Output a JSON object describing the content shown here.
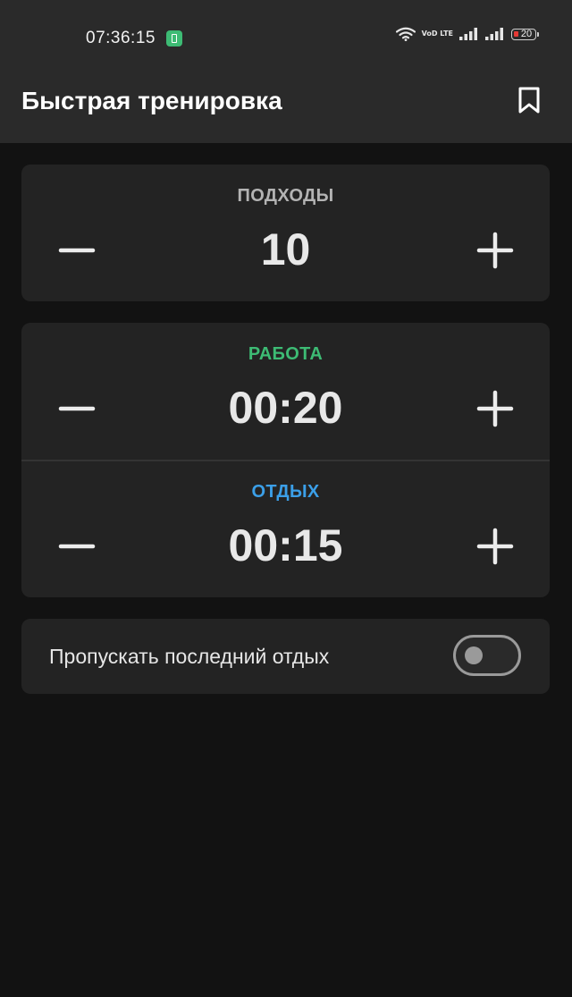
{
  "status_bar": {
    "time": "07:36:15",
    "network_label": "VoD LTE",
    "battery_level": "20"
  },
  "app_bar": {
    "title": "Быстрая тренировка"
  },
  "sets": {
    "label": "ПОДХОДЫ",
    "value": "10",
    "label_color": "#b3b3b3"
  },
  "work": {
    "label": "РАБОТА",
    "value": "00:20",
    "label_color": "#3dbb74"
  },
  "rest": {
    "label": "ОТДЫХ",
    "value": "00:15",
    "label_color": "#3b9fe8"
  },
  "skip_last_rest": {
    "label": "Пропускать последний отдых",
    "enabled": false
  },
  "icons": {
    "minus": "minus-icon",
    "plus": "plus-icon",
    "bookmark": "bookmark-icon",
    "wifi": "wifi-icon",
    "signal": "signal-icon",
    "battery": "battery-icon"
  }
}
